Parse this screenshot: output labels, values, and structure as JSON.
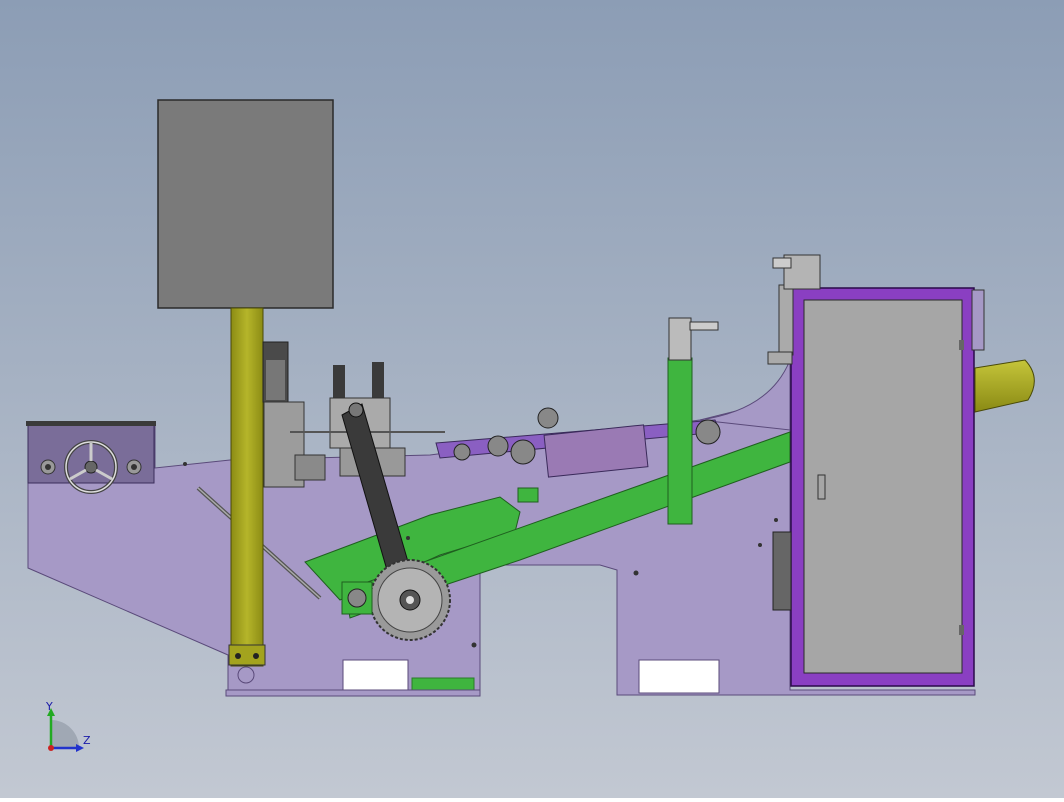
{
  "colors": {
    "background_top": "#8c9db5",
    "background_bottom": "#c2c8d2",
    "frame": "#a699c6",
    "frame_dark": "#5a4a7a",
    "panel_gray": "#7a7a7a",
    "column_yellow": "#a3a31e",
    "green": "#3fb53f",
    "green_dark": "#2a7a2a",
    "cabinet_purple": "#8a3fc2",
    "cabinet_inner": "#a6a6a6",
    "steel": "#5f5f5f",
    "gear": "#9a9a9a",
    "triad_y": "#22aa22",
    "triad_z": "#2233cc"
  },
  "triad": {
    "y_label": "Y",
    "z_label": "Z"
  }
}
